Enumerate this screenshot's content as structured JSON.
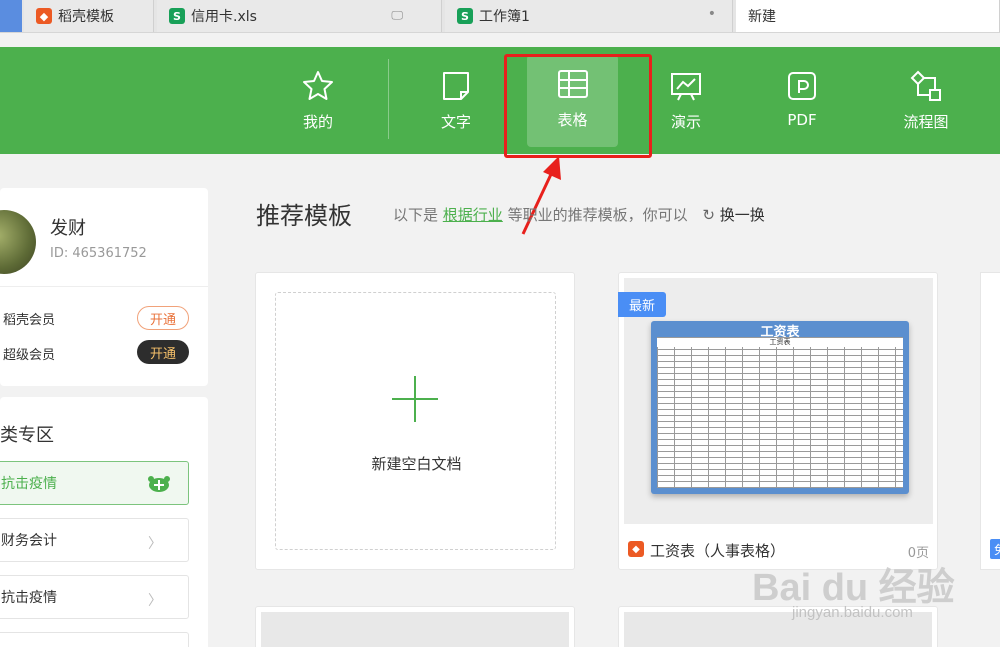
{
  "tabs": [
    {
      "label": "稻壳模板",
      "icon": "docer-icon"
    },
    {
      "label": "信用卡.xls",
      "icon": "sheet-icon"
    },
    {
      "label": "工作簿1",
      "icon": "sheet-icon"
    },
    {
      "label": "新建",
      "icon": ""
    }
  ],
  "nav": {
    "items": [
      {
        "label": "我的",
        "icon": "star-icon"
      },
      {
        "label": "文字",
        "icon": "document-icon"
      },
      {
        "label": "表格",
        "icon": "table-icon"
      },
      {
        "label": "演示",
        "icon": "presentation-icon"
      },
      {
        "label": "PDF",
        "icon": "pdf-icon"
      },
      {
        "label": "流程图",
        "icon": "flowchart-icon"
      }
    ],
    "selected": "表格"
  },
  "user": {
    "name": "发财",
    "id": "ID: 465361752",
    "memberships": [
      {
        "label": "稻壳会员",
        "action": "开通"
      },
      {
        "label": "超级会员",
        "action": "开通"
      }
    ]
  },
  "categories": {
    "title": "类专区",
    "items": [
      "抗击疫情",
      "财务会计",
      "抗击疫情"
    ]
  },
  "main": {
    "title": "推荐模板",
    "subtitle_prefix": "以下是",
    "subtitle_link": "根据行业",
    "subtitle_suffix": "等职业的推荐模板，你可以",
    "refresh": "换一换",
    "blank_label": "新建空白文档",
    "template": {
      "badge": "最新",
      "sheet_title": "工资表",
      "sheet_subtitle": "工资表",
      "name": "工资表（人事表格）",
      "pages": "0页"
    },
    "edge_badge": "免"
  },
  "watermark": {
    "text": "Bai du 经验",
    "url": "jingyan.baidu.com"
  },
  "colors": {
    "nav_green": "#4cb04d",
    "highlight_red": "#e8201c",
    "badge_blue": "#4a8ef5"
  }
}
